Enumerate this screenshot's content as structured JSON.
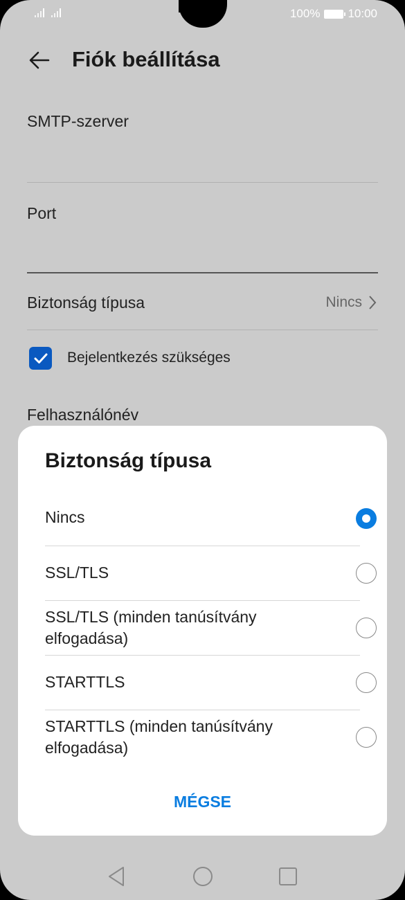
{
  "status_bar": {
    "battery_text": "100%",
    "time": "10:00"
  },
  "header": {
    "title": "Fiók beállítása"
  },
  "settings": {
    "smtp_label": "SMTP-szerver",
    "port_label": "Port",
    "security_label": "Biztonság típusa",
    "security_value": "Nincs",
    "login_required_label": "Bejelentkezés szükséges",
    "username_label": "Felhasználónév"
  },
  "dialog": {
    "title": "Biztonság típusa",
    "options": [
      {
        "label": "Nincs",
        "selected": true
      },
      {
        "label": "SSL/TLS",
        "selected": false
      },
      {
        "label": "SSL/TLS (minden tanúsítvány elfogadása)",
        "selected": false
      },
      {
        "label": "STARTTLS",
        "selected": false
      },
      {
        "label": "STARTTLS (minden tanúsítvány elfogadása)",
        "selected": false
      }
    ],
    "cancel_label": "MÉGSE"
  },
  "colors": {
    "accent": "#0a7de0",
    "checkbox": "#0a59c0",
    "background": "#cbcbcb"
  }
}
